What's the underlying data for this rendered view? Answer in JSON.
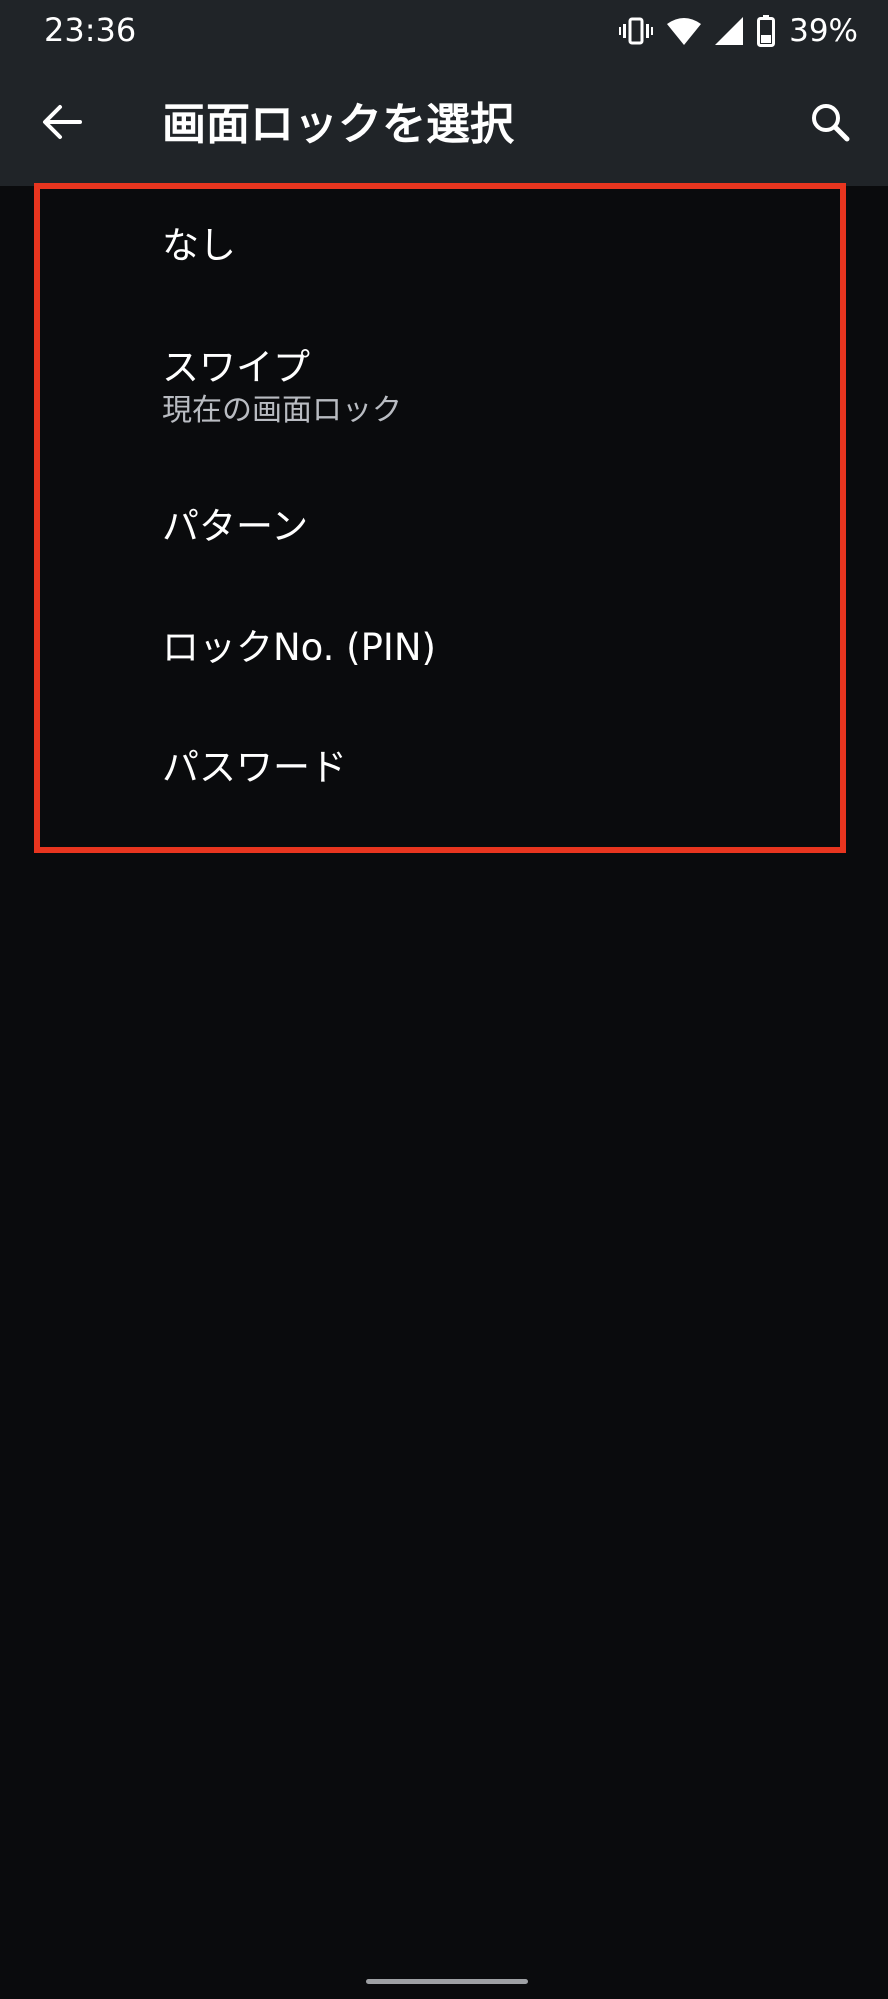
{
  "status_bar": {
    "time": "23:36",
    "battery_percent": "39%",
    "icons": [
      "vibrate-icon",
      "wifi-icon",
      "signal-icon",
      "battery-icon"
    ]
  },
  "app_bar": {
    "title": "画面ロックを選択",
    "back_icon": "arrow-left-icon",
    "search_icon": "search-icon"
  },
  "lock_options": [
    {
      "label": "なし"
    },
    {
      "label": "スワイプ",
      "summary": "現在の画面ロック"
    },
    {
      "label": "パターン"
    },
    {
      "label": "ロックNo. (PIN)"
    },
    {
      "label": "パスワード"
    }
  ],
  "colors": {
    "header_bg": "#202428",
    "page_bg": "#0a0b0d",
    "highlight": "#e8351f",
    "summary_text": "#b9bcc2"
  }
}
